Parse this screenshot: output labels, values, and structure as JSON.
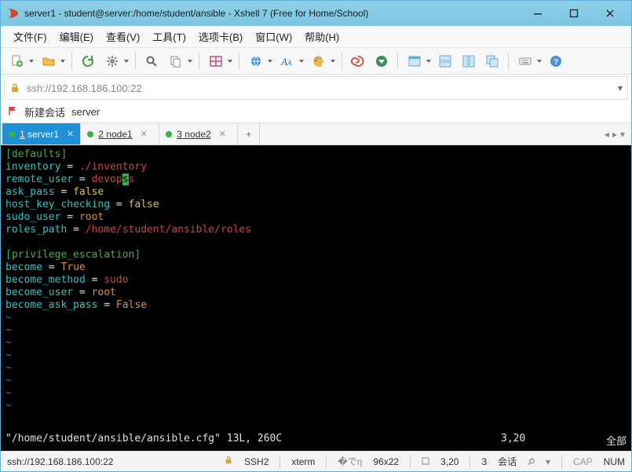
{
  "window": {
    "title": "server1 - student@server:/home/student/ansible - Xshell 7 (Free for Home/School)"
  },
  "menu": {
    "file": "文件(F)",
    "edit": "编辑(E)",
    "view": "查看(V)",
    "tools": "工具(T)",
    "tabs": "选项卡(B)",
    "window": "窗口(W)",
    "help": "帮助(H)"
  },
  "address": {
    "url": "ssh://192.168.186.100:22"
  },
  "session_quick": {
    "new_session": "新建会话",
    "server": "server"
  },
  "tabs": [
    {
      "index": "1",
      "label": "server1",
      "active": true
    },
    {
      "index": "2",
      "label": "node1",
      "active": false
    },
    {
      "index": "3",
      "label": "node2",
      "active": false
    }
  ],
  "terminal": {
    "section1": "[defaults]",
    "l1_key": "inventory",
    "l1_eq": " = ",
    "l1_val": "./inventory",
    "l2_key": "remote_user",
    "l2_eq": " = ",
    "l2_val_a": "devop",
    "l2_val_cursor": "s",
    "l2_val_b": "s",
    "l3_key": "ask_pass",
    "l3_eq": " = ",
    "l3_val": "false",
    "l4_key": "host_key_checking",
    "l4_eq": " = ",
    "l4_val": "false",
    "l5_key": "sudo_user",
    "l5_eq": " = ",
    "l5_val": "root",
    "l6_key": "roles_path",
    "l6_eq": " = ",
    "l6_val": "/home/student/ansible/roles",
    "section2": "[privilege_escalation]",
    "l7_key": "become",
    "l7_eq": " = ",
    "l7_val": "True",
    "l8_key": "become_method",
    "l8_eq": " = ",
    "l8_val": "sudo",
    "l9_key": "become_user",
    "l9_eq": " = ",
    "l9_val": "root",
    "l10_key": "become_ask_pass",
    "l10_eq": " = ",
    "l10_val": "False",
    "tilde": "~",
    "status_left": "\"/home/student/ansible/ansible.cfg\" 13L, 260C",
    "status_pos": "3,20",
    "status_all": "全部"
  },
  "statusbar": {
    "ssh": "ssh://192.168.186.100:22",
    "proto": "SSH2",
    "term": "xterm",
    "size": "96x22",
    "cursor": "3,20",
    "sessions_n": "3",
    "sessions": "会话",
    "caps": "CAP",
    "num": "NUM"
  },
  "icons": {
    "new": "new-file-icon",
    "folder": "folder-icon",
    "refresh": "refresh-icon",
    "gear": "gear-icon",
    "search": "search-icon",
    "copy": "copy-icon",
    "layout": "layout-icon",
    "globe": "globe-icon",
    "font": "font-icon",
    "palette": "palette-icon",
    "spiral": "spiral-icon",
    "xftp": "xftp-icon",
    "window": "window-icon",
    "tile-h": "tile-h-icon",
    "tile-v": "tile-v-icon",
    "step": "step-icon",
    "keyboard": "keyboard-icon",
    "help": "help-icon"
  }
}
